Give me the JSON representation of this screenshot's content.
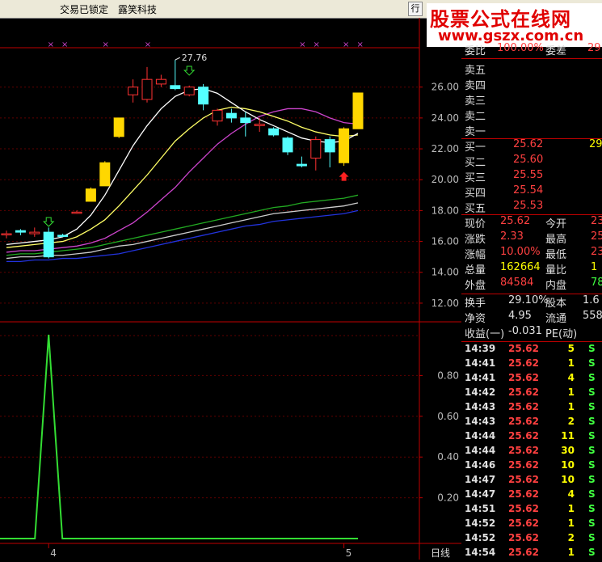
{
  "window": {
    "status_locked": "交易已锁定",
    "stock_name": "露笑科技",
    "corner_icon": "行"
  },
  "watermark": {
    "line1": "股票公式在线网",
    "line2": "www.gszx.com.cn"
  },
  "chart_data": {
    "type": "candlestick",
    "main": {
      "y_ticks": [
        "26.00",
        "24.00",
        "22.00",
        "20.00",
        "18.00",
        "16.00",
        "14.00",
        "12.00"
      ],
      "high_marker": "27.76",
      "candles": [
        {
          "o": 16.5,
          "c": 16.5,
          "h": 16.7,
          "l": 16.2,
          "col": "red"
        },
        {
          "o": 16.6,
          "c": 16.7,
          "h": 16.8,
          "l": 16.4,
          "col": "cyan"
        },
        {
          "o": 16.5,
          "c": 16.6,
          "h": 16.9,
          "l": 16.3,
          "col": "red"
        },
        {
          "o": 16.6,
          "c": 15.0,
          "h": 16.9,
          "l": 14.9,
          "col": "cyan"
        },
        {
          "o": 16.4,
          "c": 16.4,
          "h": 16.5,
          "l": 16.3,
          "col": "cyan"
        },
        {
          "o": 17.9,
          "c": 17.9,
          "h": 18.0,
          "l": 17.8,
          "col": "red"
        },
        {
          "o": 18.6,
          "c": 19.4,
          "h": 19.5,
          "l": 18.6,
          "col": "yellow"
        },
        {
          "o": 19.6,
          "c": 21.1,
          "h": 21.2,
          "l": 19.6,
          "col": "yellow"
        },
        {
          "o": 22.8,
          "c": 24.0,
          "h": 24.0,
          "l": 22.7,
          "col": "yellow"
        },
        {
          "o": 26.0,
          "c": 25.5,
          "h": 26.5,
          "l": 25.0,
          "col": "red"
        },
        {
          "o": 25.2,
          "c": 26.5,
          "h": 27.3,
          "l": 25.0,
          "col": "red"
        },
        {
          "o": 26.5,
          "c": 26.2,
          "h": 26.8,
          "l": 26.0,
          "col": "red"
        },
        {
          "o": 26.1,
          "c": 25.9,
          "h": 27.76,
          "l": 25.8,
          "col": "cyan"
        },
        {
          "o": 26.0,
          "c": 25.5,
          "h": 26.1,
          "l": 25.4,
          "col": "red"
        },
        {
          "o": 26.0,
          "c": 24.9,
          "h": 26.2,
          "l": 24.5,
          "col": "cyan"
        },
        {
          "o": 24.5,
          "c": 23.8,
          "h": 24.6,
          "l": 23.5,
          "col": "red"
        },
        {
          "o": 24.0,
          "c": 24.3,
          "h": 24.6,
          "l": 23.7,
          "col": "cyan"
        },
        {
          "o": 24.0,
          "c": 23.7,
          "h": 24.4,
          "l": 22.8,
          "col": "cyan"
        },
        {
          "o": 23.6,
          "c": 23.5,
          "h": 24.0,
          "l": 23.1,
          "col": "red"
        },
        {
          "o": 23.3,
          "c": 22.9,
          "h": 23.4,
          "l": 22.8,
          "col": "cyan"
        },
        {
          "o": 22.7,
          "c": 21.8,
          "h": 22.8,
          "l": 21.6,
          "col": "cyan"
        },
        {
          "o": 20.9,
          "c": 21.0,
          "h": 21.5,
          "l": 20.8,
          "col": "cyan"
        },
        {
          "o": 21.4,
          "c": 22.6,
          "h": 22.8,
          "l": 20.6,
          "col": "red"
        },
        {
          "o": 22.6,
          "c": 21.8,
          "h": 22.8,
          "l": 20.8,
          "col": "cyan"
        },
        {
          "o": 21.1,
          "c": 23.3,
          "h": 23.4,
          "l": 20.9,
          "col": "yellow"
        },
        {
          "o": 23.3,
          "c": 25.62,
          "h": 25.62,
          "l": 23.3,
          "col": "yellow"
        }
      ],
      "ma_white": [
        15.8,
        15.9,
        16.0,
        16.1,
        16.3,
        16.8,
        17.7,
        19.0,
        20.6,
        22.2,
        23.5,
        24.6,
        25.4,
        25.8,
        25.9,
        25.6,
        25.0,
        24.4,
        23.9,
        23.5,
        23.1,
        22.7,
        22.5,
        22.4,
        22.5,
        23.0
      ],
      "ma_yellow": [
        15.6,
        15.7,
        15.8,
        15.9,
        16.0,
        16.3,
        16.8,
        17.4,
        18.3,
        19.3,
        20.3,
        21.4,
        22.5,
        23.3,
        24.0,
        24.5,
        24.7,
        24.6,
        24.4,
        24.1,
        23.8,
        23.4,
        23.1,
        22.9,
        22.8,
        22.9
      ],
      "ma_magenta": [
        15.3,
        15.4,
        15.4,
        15.5,
        15.6,
        15.7,
        15.9,
        16.2,
        16.7,
        17.2,
        17.9,
        18.7,
        19.5,
        20.5,
        21.4,
        22.3,
        23.0,
        23.6,
        24.1,
        24.4,
        24.6,
        24.6,
        24.4,
        24.0,
        23.7,
        23.6
      ],
      "ma_green": [
        15.1,
        15.2,
        15.2,
        15.3,
        15.4,
        15.5,
        15.6,
        15.8,
        16.0,
        16.2,
        16.4,
        16.6,
        16.8,
        17.0,
        17.2,
        17.4,
        17.6,
        17.8,
        18.0,
        18.2,
        18.3,
        18.5,
        18.6,
        18.7,
        18.8,
        19.0
      ],
      "ma_cyan": [
        14.9,
        15.0,
        15.0,
        15.1,
        15.1,
        15.2,
        15.3,
        15.5,
        15.7,
        15.8,
        16.0,
        16.2,
        16.4,
        16.6,
        16.8,
        17.0,
        17.2,
        17.4,
        17.6,
        17.8,
        17.9,
        18.0,
        18.1,
        18.2,
        18.3,
        18.5
      ],
      "ma_blue": [
        14.7,
        14.7,
        14.8,
        14.8,
        14.9,
        14.9,
        15.0,
        15.1,
        15.2,
        15.4,
        15.6,
        15.8,
        16.0,
        16.2,
        16.4,
        16.6,
        16.8,
        17.0,
        17.1,
        17.3,
        17.4,
        17.5,
        17.6,
        17.7,
        17.8,
        18.0
      ]
    },
    "sub": {
      "y_ticks": [
        "0.80",
        "0.60",
        "0.40",
        "0.20"
      ],
      "values": [
        0,
        0,
        0,
        0,
        0,
        0,
        0,
        0,
        0,
        0,
        0,
        0,
        0,
        0,
        0,
        0,
        0,
        0,
        0,
        0,
        0,
        0,
        0,
        0,
        0,
        0
      ],
      "spike": {
        "index": 3,
        "value": 1.0
      }
    },
    "x_labels": [
      {
        "index": 3,
        "text": "4"
      },
      {
        "index": 24,
        "text": "5"
      }
    ],
    "period_label": "日线"
  },
  "quote": {
    "ratio_label": "委比",
    "ratio_value": "100.00%",
    "diff_label": "委差",
    "diff_value": "29",
    "sells": [
      {
        "label": "卖五",
        "price": "",
        "vol": ""
      },
      {
        "label": "卖四",
        "price": "",
        "vol": ""
      },
      {
        "label": "卖三",
        "price": "",
        "vol": ""
      },
      {
        "label": "卖二",
        "price": "",
        "vol": ""
      },
      {
        "label": "卖一",
        "price": "",
        "vol": ""
      }
    ],
    "buys": [
      {
        "label": "买一",
        "price": "25.62",
        "vol": "29"
      },
      {
        "label": "买二",
        "price": "25.60",
        "vol": ""
      },
      {
        "label": "买三",
        "price": "25.55",
        "vol": ""
      },
      {
        "label": "买四",
        "price": "25.54",
        "vol": ""
      },
      {
        "label": "买五",
        "price": "25.53",
        "vol": ""
      }
    ],
    "stats": [
      {
        "l1": "现价",
        "v1": "25.62",
        "c1": "red",
        "l2": "今开",
        "v2": "23",
        "c2": "red"
      },
      {
        "l1": "涨跌",
        "v1": "2.33",
        "c1": "red",
        "l2": "最高",
        "v2": "25",
        "c2": "red"
      },
      {
        "l1": "涨幅",
        "v1": "10.00%",
        "c1": "red",
        "l2": "最低",
        "v2": "23",
        "c2": "red"
      },
      {
        "l1": "总量",
        "v1": "162664",
        "c1": "yel",
        "l2": "量比",
        "v2": "1",
        "c2": "yel"
      },
      {
        "l1": "外盘",
        "v1": "84584",
        "c1": "red",
        "l2": "内盘",
        "v2": "78",
        "c2": "grn"
      }
    ],
    "stats2": [
      {
        "l1": "换手",
        "v1": "29.10%",
        "l2": "股本",
        "v2": "1.6"
      },
      {
        "l1": "净资",
        "v1": "4.95",
        "l2": "流通",
        "v2": "558"
      },
      {
        "l1": "收益(一)",
        "v1": "-0.031",
        "l2": "PE(动)",
        "v2": ""
      }
    ]
  },
  "trades": [
    {
      "time": "14:39",
      "price": "25.62",
      "vol": "5",
      "side": "S"
    },
    {
      "time": "14:41",
      "price": "25.62",
      "vol": "1",
      "side": "S"
    },
    {
      "time": "14:41",
      "price": "25.62",
      "vol": "4",
      "side": "S"
    },
    {
      "time": "14:42",
      "price": "25.62",
      "vol": "1",
      "side": "S"
    },
    {
      "time": "14:43",
      "price": "25.62",
      "vol": "1",
      "side": "S"
    },
    {
      "time": "14:43",
      "price": "25.62",
      "vol": "2",
      "side": "S"
    },
    {
      "time": "14:44",
      "price": "25.62",
      "vol": "11",
      "side": "S"
    },
    {
      "time": "14:44",
      "price": "25.62",
      "vol": "30",
      "side": "S"
    },
    {
      "time": "14:46",
      "price": "25.62",
      "vol": "10",
      "side": "S"
    },
    {
      "time": "14:47",
      "price": "25.62",
      "vol": "10",
      "side": "S"
    },
    {
      "time": "14:47",
      "price": "25.62",
      "vol": "4",
      "side": "S"
    },
    {
      "time": "14:51",
      "price": "25.62",
      "vol": "1",
      "side": "S"
    },
    {
      "time": "14:52",
      "price": "25.62",
      "vol": "1",
      "side": "S"
    },
    {
      "time": "14:52",
      "price": "25.62",
      "vol": "2",
      "side": "S"
    },
    {
      "time": "14:54",
      "price": "25.62",
      "vol": "1",
      "side": "S"
    }
  ],
  "colors": {
    "up": "#ff3232",
    "down": "#54ffff",
    "limit": "#ffd700",
    "axis": "#c00000",
    "ma_white": "#ffffff",
    "ma_yellow": "#ffff66",
    "ma_magenta": "#cc44cc",
    "ma_green": "#22aa22",
    "ma_cyan": "#cccccc",
    "ma_blue": "#2233dd",
    "sub_line": "#33dd33"
  }
}
